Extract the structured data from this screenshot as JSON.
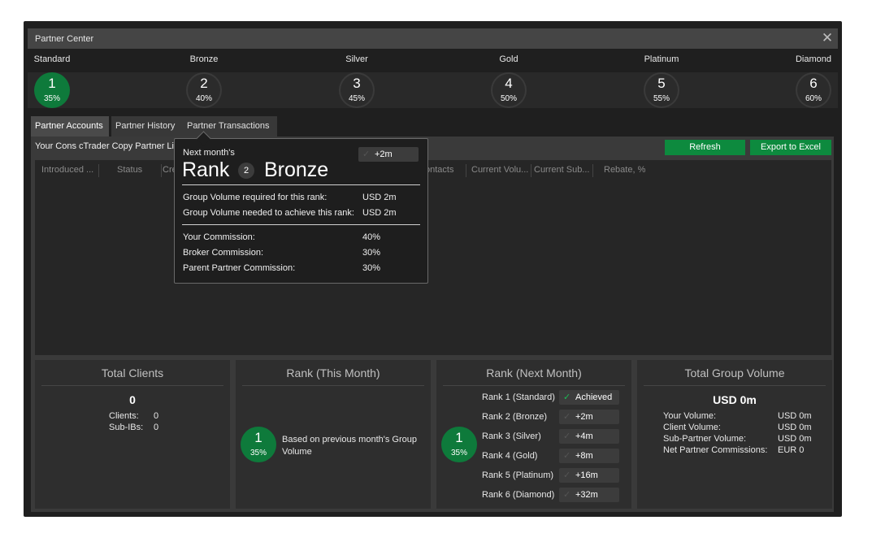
{
  "window": {
    "title": "Partner Center",
    "close_icon": "close-icon"
  },
  "ranks": [
    {
      "name": "Standard",
      "number": "1",
      "percent": "35%",
      "active": true
    },
    {
      "name": "Bronze",
      "number": "2",
      "percent": "40%",
      "active": false
    },
    {
      "name": "Silver",
      "number": "3",
      "percent": "45%",
      "active": false
    },
    {
      "name": "Gold",
      "number": "4",
      "percent": "50%",
      "active": false
    },
    {
      "name": "Platinum",
      "number": "5",
      "percent": "55%",
      "active": false
    },
    {
      "name": "Diamond",
      "number": "6",
      "percent": "60%",
      "active": false
    }
  ],
  "tabs": [
    {
      "label": "Partner Accounts",
      "active": true
    },
    {
      "label": "Partner History",
      "active": false
    },
    {
      "label": "Partner Transactions",
      "active": false
    }
  ],
  "toolbar": {
    "heading": "Your Cons cTrader Copy Partner Li",
    "refresh": "Refresh",
    "export": "Export to Excel"
  },
  "grid": {
    "columns": [
      "Introduced ...",
      "Status",
      "Cre",
      "ontacts",
      "Current Volu...",
      "Current Sub...",
      "Rebate, %"
    ]
  },
  "cards": {
    "total_clients": {
      "title": "Total Clients",
      "value": "0",
      "clients_label": "Clients:",
      "clients": "0",
      "subibs_label": "Sub-IBs:",
      "subibs": "0"
    },
    "rank_this_month": {
      "title": "Rank (This Month)",
      "number": "1",
      "percent": "35%",
      "text": "Based on previous month's Group Volume"
    },
    "rank_next_month": {
      "title": "Rank (Next Month)",
      "number": "1",
      "percent": "35%",
      "rows": [
        {
          "label": "Rank 1 (Standard)",
          "value": "Achieved",
          "achieved": true
        },
        {
          "label": "Rank 2 (Bronze)",
          "value": "+2m",
          "achieved": false
        },
        {
          "label": "Rank 3 (Silver)",
          "value": "+4m",
          "achieved": false
        },
        {
          "label": "Rank 4 (Gold)",
          "value": "+8m",
          "achieved": false
        },
        {
          "label": "Rank 5 (Platinum)",
          "value": "+16m",
          "achieved": false
        },
        {
          "label": "Rank 6 (Diamond)",
          "value": "+32m",
          "achieved": false
        }
      ]
    },
    "total_group_volume": {
      "title": "Total Group Volume",
      "value": "USD 0m",
      "rows": [
        {
          "label": "Your Volume:",
          "value": "USD 0m"
        },
        {
          "label": "Client Volume:",
          "value": "USD 0m"
        },
        {
          "label": "Sub-Partner Volume:",
          "value": "USD 0m"
        },
        {
          "label": "Net Partner Commissions:",
          "value": "EUR 0"
        }
      ]
    }
  },
  "tooltip": {
    "subtitle": "Next month's",
    "rank_word": "Rank",
    "rank_number": "2",
    "rank_name": "Bronze",
    "pill_value": "+2m",
    "rows1": [
      {
        "label": "Group Volume required for this rank:",
        "value": "USD 2m"
      },
      {
        "label": "Group Volume needed to achieve this rank:",
        "value": "USD 2m"
      }
    ],
    "rows2": [
      {
        "label": "Your Commission:",
        "value": "40%"
      },
      {
        "label": "Broker Commission:",
        "value": "30%"
      },
      {
        "label": "Parent Partner Commission:",
        "value": "30%"
      }
    ]
  },
  "colors": {
    "accent_green": "#0d8a3e",
    "check_green": "#1db954",
    "background": "#1f1f1f"
  }
}
